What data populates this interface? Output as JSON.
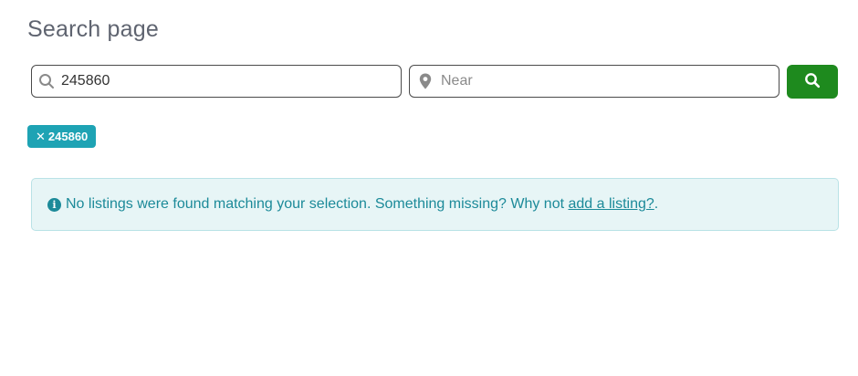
{
  "page": {
    "title": "Search page"
  },
  "search": {
    "keyword_value": "245860",
    "near_placeholder": "Near",
    "near_value": ""
  },
  "filters": [
    {
      "label": "245860"
    }
  ],
  "alert": {
    "message": "No listings were found matching your selection. Something missing? Why not ",
    "link_text": "add a listing?",
    "suffix": "."
  },
  "colors": {
    "search_button": "#1e8a1e",
    "chip": "#1ea3b4",
    "alert_text": "#1c8a99",
    "alert_bg": "#e7f5f6"
  },
  "icons": {
    "keyword_field": "search-icon",
    "near_field": "map-marker-icon",
    "search_button": "search-icon",
    "chip_remove": "close-icon",
    "alert": "info-circle-icon"
  }
}
